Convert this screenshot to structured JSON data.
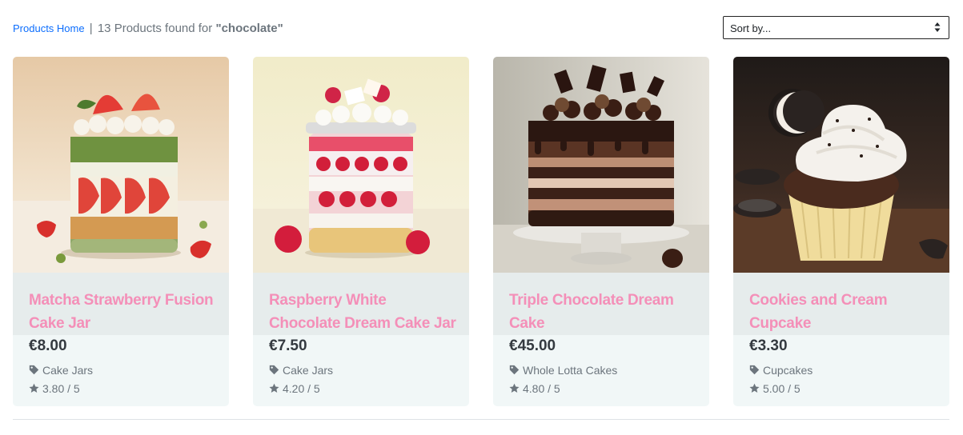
{
  "breadcrumb": {
    "home_label": "Products Home",
    "separator": "|",
    "count_text": "13 Products found for",
    "query": "\"chocolate\""
  },
  "sort": {
    "selected": "Sort by..."
  },
  "products": [
    {
      "title": "Matcha Strawberry Fusion Cake Jar",
      "price": "€8.00",
      "category": "Cake Jars",
      "rating": "3.80 / 5",
      "image": "matcha-strawberry-cake-jar-photo"
    },
    {
      "title": "Raspberry White Chocolate Dream Cake Jar",
      "price": "€7.50",
      "category": "Cake Jars",
      "rating": "4.20 / 5",
      "image": "raspberry-white-chocolate-cake-jar-photo"
    },
    {
      "title": "Triple Chocolate Dream Cake",
      "price": "€45.00",
      "category": "Whole Lotta Cakes",
      "rating": "4.80 / 5",
      "image": "triple-chocolate-cake-photo"
    },
    {
      "title": "Cookies and Cream Cupcake",
      "price": "€3.30",
      "category": "Cupcakes",
      "rating": "5.00 / 5",
      "image": "cookies-and-cream-cupcake-photo"
    }
  ],
  "icons": {
    "category": "tag-icon",
    "rating": "star-icon",
    "sort": "sort-arrows-icon"
  },
  "colors": {
    "link": "#0d6efd",
    "product_title": "#f48fb8",
    "card_background": "#f1f7f7"
  }
}
